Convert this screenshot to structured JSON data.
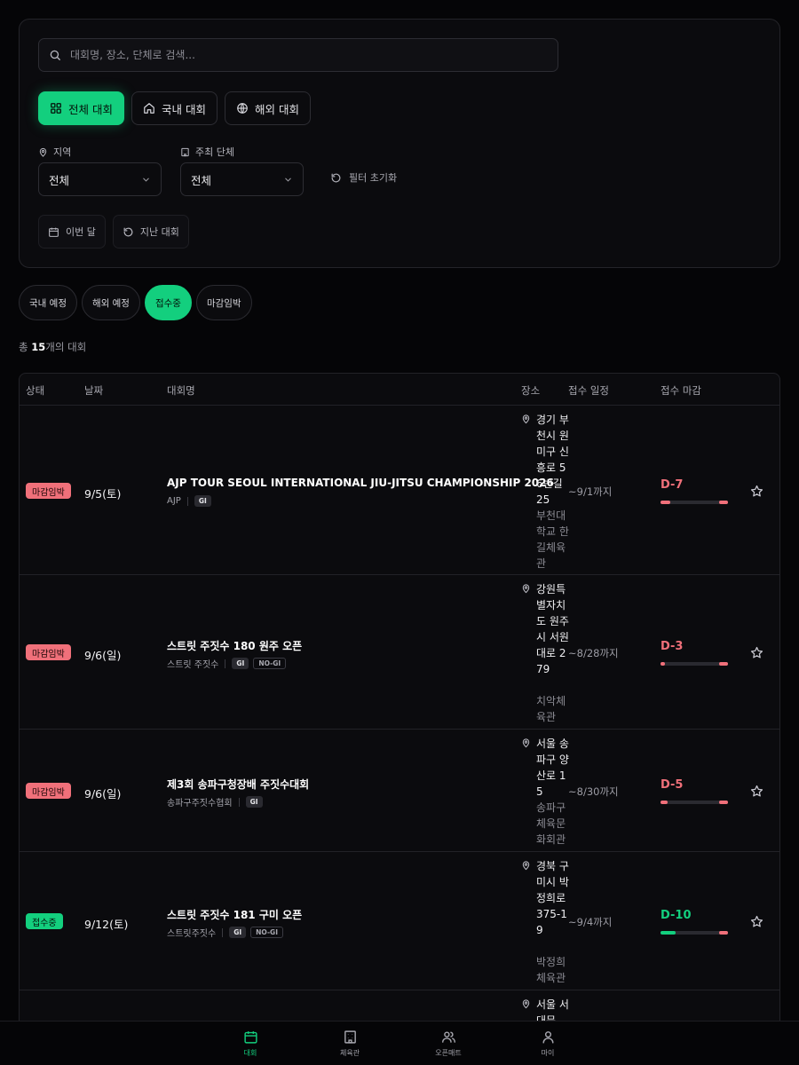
{
  "search": {
    "placeholder": "대회명, 장소, 단체로 검색..."
  },
  "scope_tabs": [
    {
      "label": "전체 대회",
      "active": true
    },
    {
      "label": "국내 대회",
      "active": false
    },
    {
      "label": "해외 대회",
      "active": false
    }
  ],
  "filters": {
    "region_label": "지역",
    "region_value": "전체",
    "host_label": "주최 단체",
    "host_value": "전체",
    "reset_label": "필터 초기화"
  },
  "quick_chips": [
    "이번 달",
    "지난 대회"
  ],
  "status_pills": [
    {
      "label": "국내 예정",
      "active": false
    },
    {
      "label": "해외 예정",
      "active": false
    },
    {
      "label": "접수중",
      "active": true
    },
    {
      "label": "마감임박",
      "active": false
    }
  ],
  "total": {
    "prefix": "총 ",
    "count": "15",
    "suffix": "개의 대회"
  },
  "table": {
    "headers": {
      "status": "상태",
      "date": "날짜",
      "name": "대회명",
      "venue": "장소",
      "schedule": "접수 일정",
      "deadline": "접수 마감"
    },
    "rows": [
      {
        "status": "마감임박",
        "status_color": "red",
        "date": "9/5(토)",
        "name": "AJP TOUR SEOUL INTERNATIONAL JIU-JITSU CHAMPIONSHIP 2026",
        "org": "AJP",
        "tags": [
          "GI"
        ],
        "address": "경기 부천시 원미구 신흥로 56번길 25",
        "hall": "부천대학교 한길체육관",
        "until": "~9/1까지",
        "dday": "D-7",
        "progress": 0.15
      },
      {
        "status": "마감임박",
        "status_color": "red",
        "date": "9/6(일)",
        "name": "스트릿 주짓수 180 원주 오픈",
        "org": "스트릿 주짓수",
        "tags": [
          "GI",
          "NO-GI"
        ],
        "address": "강원특별자치도 원주시 서원대로 279",
        "hall": "치악체육관",
        "until": "~8/28까지",
        "dday": "D-3",
        "progress": 0.07
      },
      {
        "status": "마감임박",
        "status_color": "red",
        "date": "9/6(일)",
        "name": "제3회 송파구청장배 주짓수대회",
        "org": "송파구주짓수협회",
        "tags": [
          "GI"
        ],
        "address": "서울 송파구 양산로 15",
        "hall": "송파구체육문화회관",
        "until": "~8/30까지",
        "dday": "D-5",
        "progress": 0.11
      },
      {
        "status": "접수중",
        "status_color": "green",
        "date": "9/12(토)",
        "name": "스트릿 주짓수 181 구미 오픈",
        "org": "스트릿주짓수",
        "tags": [
          "GI",
          "NO-GI"
        ],
        "address": "경북 구미시 박정희로 375-19",
        "hall": "박정희체육관",
        "until": "~9/4까지",
        "dday": "D-10",
        "progress": 0.22
      },
      {
        "address": "서울 서대문"
      }
    ]
  },
  "bottom_nav": [
    {
      "label": "대회",
      "icon": "calendar-icon",
      "active": true
    },
    {
      "label": "체육관",
      "icon": "building-icon",
      "active": false
    },
    {
      "label": "오픈매트",
      "icon": "users-icon",
      "active": false
    },
    {
      "label": "마이",
      "icon": "user-icon",
      "active": false
    }
  ],
  "colors": {
    "accent": "#13cf7e",
    "urgent": "#f0707a",
    "background": "#050507"
  }
}
